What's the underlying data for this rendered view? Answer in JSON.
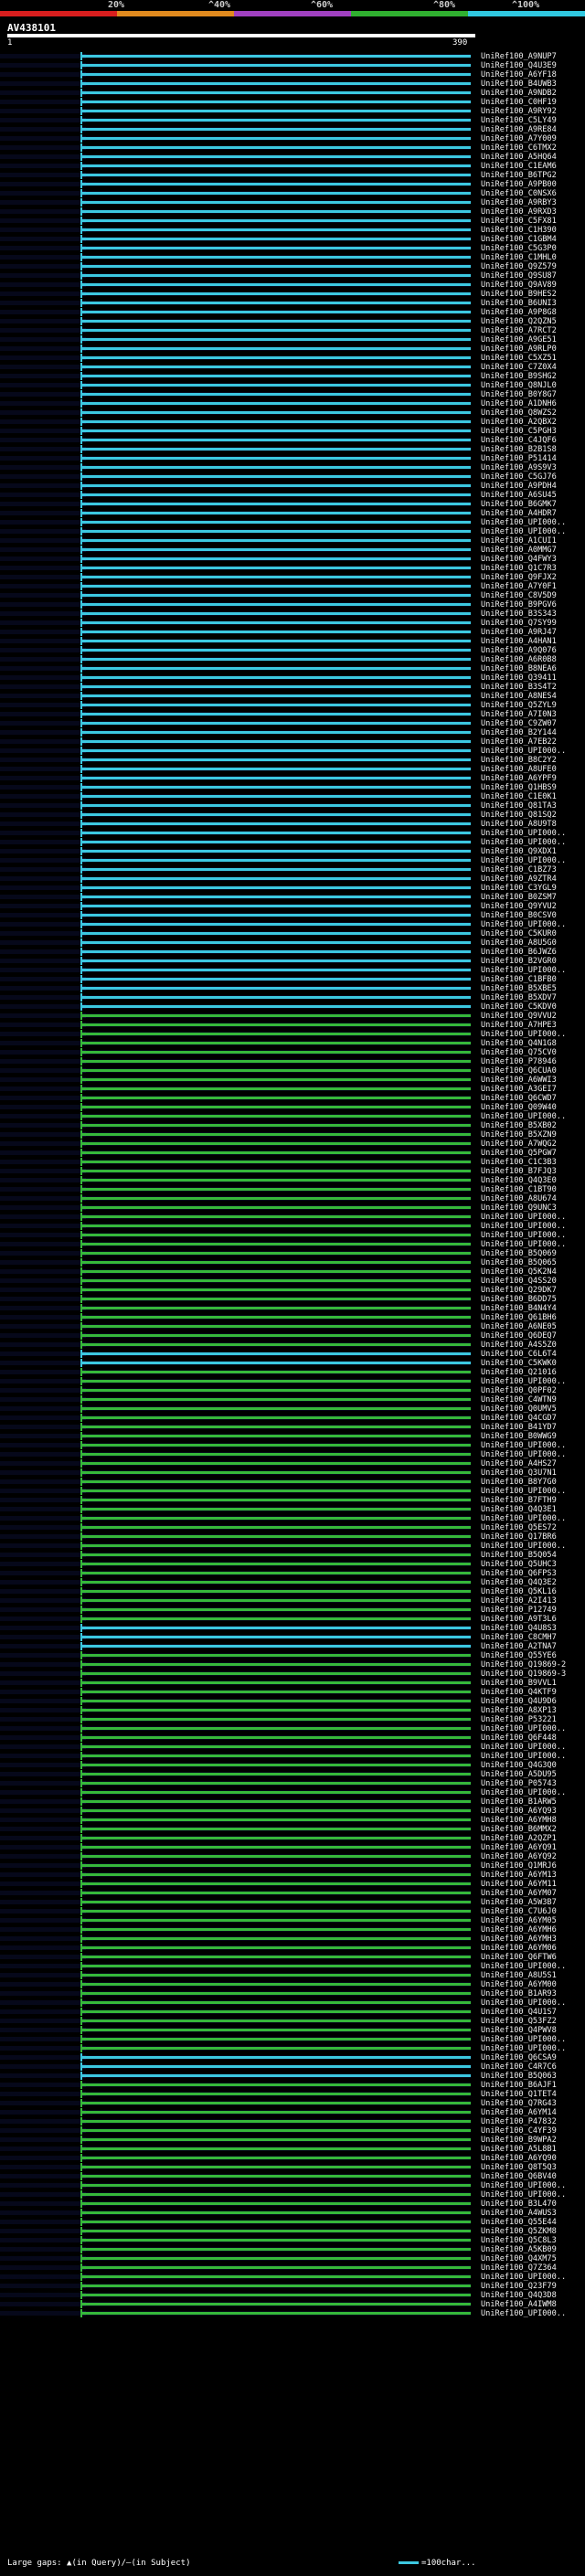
{
  "legend": {
    "labels": [
      "20%",
      "^40%",
      "^60%",
      "^80%",
      "^100%"
    ],
    "colors": [
      "#d81e1e",
      "#e08a1e",
      "#a040c0",
      "#30b030",
      "#30c8e0"
    ]
  },
  "query": {
    "name": "AV438101",
    "start": "1",
    "end": "390"
  },
  "colors": {
    "green": "#36b83a",
    "blue": "#3cc8e0",
    "background": "#000000"
  },
  "hits": [
    {
      "acc": "UniRef100_A9NUP7",
      "c": "blue"
    },
    {
      "acc": "UniRef100_Q4U3E9",
      "c": "blue"
    },
    {
      "acc": "UniRef100_A6YF18",
      "c": "blue"
    },
    {
      "acc": "UniRef100_B4UWB3",
      "c": "blue"
    },
    {
      "acc": "UniRef100_A9NDB2",
      "c": "blue"
    },
    {
      "acc": "UniRef100_C0HF19",
      "c": "blue"
    },
    {
      "acc": "UniRef100_A9RY92",
      "c": "blue"
    },
    {
      "acc": "UniRef100_C5LY49",
      "c": "blue"
    },
    {
      "acc": "UniRef100_A9RE84",
      "c": "blue"
    },
    {
      "acc": "UniRef100_A7Y009",
      "c": "blue"
    },
    {
      "acc": "UniRef100_C6TMX2",
      "c": "blue"
    },
    {
      "acc": "UniRef100_A5HQ64",
      "c": "blue"
    },
    {
      "acc": "UniRef100_C1EAM6",
      "c": "blue"
    },
    {
      "acc": "UniRef100_B6TPG2",
      "c": "blue"
    },
    {
      "acc": "UniRef100_A9PB00",
      "c": "blue"
    },
    {
      "acc": "UniRef100_C0NSX6",
      "c": "blue"
    },
    {
      "acc": "UniRef100_A9RBY3",
      "c": "blue"
    },
    {
      "acc": "UniRef100_A9RXD3",
      "c": "blue"
    },
    {
      "acc": "UniRef100_C5FX81",
      "c": "blue"
    },
    {
      "acc": "UniRef100_C1H390",
      "c": "blue"
    },
    {
      "acc": "UniRef100_C1GBM4",
      "c": "blue"
    },
    {
      "acc": "UniRef100_C5G3P0",
      "c": "blue"
    },
    {
      "acc": "UniRef100_C1MHL0",
      "c": "blue"
    },
    {
      "acc": "UniRef100_Q9Z579",
      "c": "blue"
    },
    {
      "acc": "UniRef100_Q9SU87",
      "c": "blue"
    },
    {
      "acc": "UniRef100_Q9AV89",
      "c": "blue"
    },
    {
      "acc": "UniRef100_B9HES2",
      "c": "blue"
    },
    {
      "acc": "UniRef100_B6UNI3",
      "c": "blue"
    },
    {
      "acc": "UniRef100_A9P8G8",
      "c": "blue"
    },
    {
      "acc": "UniRef100_Q2QZN5",
      "c": "blue"
    },
    {
      "acc": "UniRef100_A7RCT2",
      "c": "blue"
    },
    {
      "acc": "UniRef100_A9GE51",
      "c": "blue"
    },
    {
      "acc": "UniRef100_A9RLP0",
      "c": "blue"
    },
    {
      "acc": "UniRef100_C5XZ51",
      "c": "blue"
    },
    {
      "acc": "UniRef100_C7Z0X4",
      "c": "blue"
    },
    {
      "acc": "UniRef100_B9SHG2",
      "c": "blue"
    },
    {
      "acc": "UniRef100_Q8NJL0",
      "c": "blue"
    },
    {
      "acc": "UniRef100_B0Y8G7",
      "c": "blue"
    },
    {
      "acc": "UniRef100_A1DNH6",
      "c": "blue"
    },
    {
      "acc": "UniRef100_Q8WZS2",
      "c": "blue"
    },
    {
      "acc": "UniRef100_A2QBX2",
      "c": "blue"
    },
    {
      "acc": "UniRef100_C5PGH3",
      "c": "blue"
    },
    {
      "acc": "UniRef100_C4JQF6",
      "c": "blue"
    },
    {
      "acc": "UniRef100_B2B1S8",
      "c": "blue"
    },
    {
      "acc": "UniRef100_P51414",
      "c": "blue"
    },
    {
      "acc": "UniRef100_A9S9V3",
      "c": "blue"
    },
    {
      "acc": "UniRef100_C5GJ76",
      "c": "blue"
    },
    {
      "acc": "UniRef100_A9PDH4",
      "c": "blue"
    },
    {
      "acc": "UniRef100_A6SU45",
      "c": "blue"
    },
    {
      "acc": "UniRef100_B6GMK7",
      "c": "blue"
    },
    {
      "acc": "UniRef100_A4HDR7",
      "c": "blue"
    },
    {
      "acc": "UniRef100_UPI000..",
      "c": "blue"
    },
    {
      "acc": "UniRef100_UPI000..",
      "c": "blue"
    },
    {
      "acc": "UniRef100_A1CUI1",
      "c": "blue"
    },
    {
      "acc": "UniRef100_A0MMG7",
      "c": "blue"
    },
    {
      "acc": "UniRef100_Q4FWY3",
      "c": "blue"
    },
    {
      "acc": "UniRef100_Q1C7R3",
      "c": "blue"
    },
    {
      "acc": "UniRef100_Q9FJX2",
      "c": "blue"
    },
    {
      "acc": "UniRef100_A7Y0F1",
      "c": "blue"
    },
    {
      "acc": "UniRef100_C8V5D9",
      "c": "blue"
    },
    {
      "acc": "UniRef100_B9PGV6",
      "c": "blue"
    },
    {
      "acc": "UniRef100_B3S343",
      "c": "blue"
    },
    {
      "acc": "UniRef100_Q7SY99",
      "c": "blue"
    },
    {
      "acc": "UniRef100_A9RJ47",
      "c": "blue"
    },
    {
      "acc": "UniRef100_A4HAN1",
      "c": "blue"
    },
    {
      "acc": "UniRef100_A9Q076",
      "c": "blue"
    },
    {
      "acc": "UniRef100_A6R0B8",
      "c": "blue"
    },
    {
      "acc": "UniRef100_B8NEA6",
      "c": "blue"
    },
    {
      "acc": "UniRef100_Q39411",
      "c": "blue"
    },
    {
      "acc": "UniRef100_B3S4T2",
      "c": "blue"
    },
    {
      "acc": "UniRef100_A8NES4",
      "c": "blue"
    },
    {
      "acc": "UniRef100_Q5ZYL9",
      "c": "blue"
    },
    {
      "acc": "UniRef100_A7I0N3",
      "c": "blue"
    },
    {
      "acc": "UniRef100_C9ZW07",
      "c": "blue"
    },
    {
      "acc": "UniRef100_B2Y144",
      "c": "blue"
    },
    {
      "acc": "UniRef100_A7EB22",
      "c": "blue"
    },
    {
      "acc": "UniRef100_UPI000..",
      "c": "blue"
    },
    {
      "acc": "UniRef100_B8C2Y2",
      "c": "blue"
    },
    {
      "acc": "UniRef100_A8UFE0",
      "c": "blue"
    },
    {
      "acc": "UniRef100_A6YPF9",
      "c": "blue"
    },
    {
      "acc": "UniRef100_Q1HBS9",
      "c": "blue"
    },
    {
      "acc": "UniRef100_C1E0K1",
      "c": "blue"
    },
    {
      "acc": "UniRef100_Q81TA3",
      "c": "blue"
    },
    {
      "acc": "UniRef100_Q81SQ2",
      "c": "blue"
    },
    {
      "acc": "UniRef100_A8U9T8",
      "c": "blue"
    },
    {
      "acc": "UniRef100_UPI000..",
      "c": "blue"
    },
    {
      "acc": "UniRef100_UPI000..",
      "c": "blue"
    },
    {
      "acc": "UniRef100_Q9XDX1",
      "c": "blue"
    },
    {
      "acc": "UniRef100_UPI000..",
      "c": "blue"
    },
    {
      "acc": "UniRef100_C1BZ73",
      "c": "blue"
    },
    {
      "acc": "UniRef100_A9ZTR4",
      "c": "blue"
    },
    {
      "acc": "UniRef100_C3YGL9",
      "c": "blue"
    },
    {
      "acc": "UniRef100_B0ZSM7",
      "c": "blue"
    },
    {
      "acc": "UniRef100_Q9YVU2",
      "c": "blue"
    },
    {
      "acc": "UniRef100_B0CSV0",
      "c": "blue"
    },
    {
      "acc": "UniRef100_UPI000..",
      "c": "blue"
    },
    {
      "acc": "UniRef100_C5KUR0",
      "c": "blue"
    },
    {
      "acc": "UniRef100_A8U5G0",
      "c": "blue"
    },
    {
      "acc": "UniRef100_B6JWZ6",
      "c": "blue"
    },
    {
      "acc": "UniRef100_B2VGR0",
      "c": "blue"
    },
    {
      "acc": "UniRef100_UPI000..",
      "c": "blue"
    },
    {
      "acc": "UniRef100_C1BFB0",
      "c": "blue"
    },
    {
      "acc": "UniRef100_B5XBE5",
      "c": "blue"
    },
    {
      "acc": "UniRef100_B5XDV7",
      "c": "blue"
    },
    {
      "acc": "UniRef100_C5KDV0",
      "c": "blue"
    },
    {
      "acc": "UniRef100_Q9VVU2",
      "c": "green"
    },
    {
      "acc": "UniRef100_A7HPE3",
      "c": "green"
    },
    {
      "acc": "UniRef100_UPI000..",
      "c": "green"
    },
    {
      "acc": "UniRef100_Q4N1G8",
      "c": "green"
    },
    {
      "acc": "UniRef100_Q75CV0",
      "c": "green"
    },
    {
      "acc": "UniRef100_P78946",
      "c": "green"
    },
    {
      "acc": "UniRef100_Q6CUA0",
      "c": "green"
    },
    {
      "acc": "UniRef100_A6WWI3",
      "c": "green"
    },
    {
      "acc": "UniRef100_A3GEI7",
      "c": "green"
    },
    {
      "acc": "UniRef100_Q6CWD7",
      "c": "green"
    },
    {
      "acc": "UniRef100_Q09W40",
      "c": "green"
    },
    {
      "acc": "UniRef100_UPI000..",
      "c": "green"
    },
    {
      "acc": "UniRef100_B5XB02",
      "c": "green"
    },
    {
      "acc": "UniRef100_B5XZN9",
      "c": "green"
    },
    {
      "acc": "UniRef100_A7WQG2",
      "c": "green"
    },
    {
      "acc": "UniRef100_Q5PGW7",
      "c": "green"
    },
    {
      "acc": "UniRef100_C1C3B3",
      "c": "green"
    },
    {
      "acc": "UniRef100_B7FJQ3",
      "c": "green"
    },
    {
      "acc": "UniRef100_Q4Q3E0",
      "c": "green"
    },
    {
      "acc": "UniRef100_C1BT90",
      "c": "green"
    },
    {
      "acc": "UniRef100_A8U674",
      "c": "green"
    },
    {
      "acc": "UniRef100_Q9UNC3",
      "c": "green"
    },
    {
      "acc": "UniRef100_UPI000..",
      "c": "green"
    },
    {
      "acc": "UniRef100_UPI000..",
      "c": "green"
    },
    {
      "acc": "UniRef100_UPI000..",
      "c": "green"
    },
    {
      "acc": "UniRef100_UPI000..",
      "c": "green"
    },
    {
      "acc": "UniRef100_B5Q069",
      "c": "green"
    },
    {
      "acc": "UniRef100_B5Q065",
      "c": "green"
    },
    {
      "acc": "UniRef100_Q5K2N4",
      "c": "green"
    },
    {
      "acc": "UniRef100_Q4SS20",
      "c": "green"
    },
    {
      "acc": "UniRef100_Q29DK7",
      "c": "green"
    },
    {
      "acc": "UniRef100_B6DD75",
      "c": "green"
    },
    {
      "acc": "UniRef100_B4N4Y4",
      "c": "green"
    },
    {
      "acc": "UniRef100_Q61BH6",
      "c": "green"
    },
    {
      "acc": "UniRef100_A6NE05",
      "c": "green"
    },
    {
      "acc": "UniRef100_Q6DEQ7",
      "c": "green"
    },
    {
      "acc": "UniRef100_A4S5Z0",
      "c": "green"
    },
    {
      "acc": "UniRef100_C6L6T4",
      "c": "blue"
    },
    {
      "acc": "UniRef100_C5KWK0",
      "c": "blue"
    },
    {
      "acc": "UniRef100_Q21016",
      "c": "green"
    },
    {
      "acc": "UniRef100_UPI000..",
      "c": "green"
    },
    {
      "acc": "UniRef100_Q0PF02",
      "c": "green"
    },
    {
      "acc": "UniRef100_C4WTN9",
      "c": "green"
    },
    {
      "acc": "UniRef100_Q0UMV5",
      "c": "green"
    },
    {
      "acc": "UniRef100_Q4CGD7",
      "c": "green"
    },
    {
      "acc": "UniRef100_B41YD7",
      "c": "green"
    },
    {
      "acc": "UniRef100_B0WWG9",
      "c": "green"
    },
    {
      "acc": "UniRef100_UPI000..",
      "c": "green"
    },
    {
      "acc": "UniRef100_UPI000..",
      "c": "green"
    },
    {
      "acc": "UniRef100_A4HS27",
      "c": "green"
    },
    {
      "acc": "UniRef100_Q3U7N1",
      "c": "green"
    },
    {
      "acc": "UniRef100_B8Y7G0",
      "c": "green"
    },
    {
      "acc": "UniRef100_UPI000..",
      "c": "green"
    },
    {
      "acc": "UniRef100_B7FTH9",
      "c": "green"
    },
    {
      "acc": "UniRef100_Q4Q3E1",
      "c": "green"
    },
    {
      "acc": "UniRef100_UPI000..",
      "c": "green"
    },
    {
      "acc": "UniRef100_Q5ES72",
      "c": "green"
    },
    {
      "acc": "UniRef100_Q17BR6",
      "c": "green"
    },
    {
      "acc": "UniRef100_UPI000..",
      "c": "green"
    },
    {
      "acc": "UniRef100_B5Q054",
      "c": "green"
    },
    {
      "acc": "UniRef100_Q5UHC3",
      "c": "green"
    },
    {
      "acc": "UniRef100_Q6FPS3",
      "c": "green"
    },
    {
      "acc": "UniRef100_Q4Q3E2",
      "c": "green"
    },
    {
      "acc": "UniRef100_Q5KL16",
      "c": "green"
    },
    {
      "acc": "UniRef100_A2I413",
      "c": "green"
    },
    {
      "acc": "UniRef100_P12749",
      "c": "green"
    },
    {
      "acc": "UniRef100_A9T3L6",
      "c": "green"
    },
    {
      "acc": "UniRef100_Q4U8S3",
      "c": "blue"
    },
    {
      "acc": "UniRef100_C8CMH7",
      "c": "blue"
    },
    {
      "acc": "UniRef100_A2TNA7",
      "c": "blue"
    },
    {
      "acc": "UniRef100_Q55YE6",
      "c": "green"
    },
    {
      "acc": "UniRef100_Q19869-2",
      "c": "green"
    },
    {
      "acc": "UniRef100_Q19869-3",
      "c": "green"
    },
    {
      "acc": "UniRef100_B9VVL1",
      "c": "green"
    },
    {
      "acc": "UniRef100_Q4KTF9",
      "c": "green"
    },
    {
      "acc": "UniRef100_Q4U9D6",
      "c": "green"
    },
    {
      "acc": "UniRef100_A8XP13",
      "c": "green"
    },
    {
      "acc": "UniRef100_P53221",
      "c": "green"
    },
    {
      "acc": "UniRef100_UPI000..",
      "c": "green"
    },
    {
      "acc": "UniRef100_Q6F448",
      "c": "green"
    },
    {
      "acc": "UniRef100_UPI000..",
      "c": "green"
    },
    {
      "acc": "UniRef100_UPI000..",
      "c": "green"
    },
    {
      "acc": "UniRef100_Q4G3Q0",
      "c": "green"
    },
    {
      "acc": "UniRef100_A5DU95",
      "c": "green"
    },
    {
      "acc": "UniRef100_P05743",
      "c": "green"
    },
    {
      "acc": "UniRef100_UPI000..",
      "c": "green"
    },
    {
      "acc": "UniRef100_B1ARW5",
      "c": "green"
    },
    {
      "acc": "UniRef100_A6YQ93",
      "c": "green"
    },
    {
      "acc": "UniRef100_A6YMH8",
      "c": "green"
    },
    {
      "acc": "UniRef100_B6MMX2",
      "c": "green"
    },
    {
      "acc": "UniRef100_A2QZP1",
      "c": "green"
    },
    {
      "acc": "UniRef100_A6YQ91",
      "c": "green"
    },
    {
      "acc": "UniRef100_A6YQ92",
      "c": "green"
    },
    {
      "acc": "UniRef100_Q1MRJ6",
      "c": "green"
    },
    {
      "acc": "UniRef100_A6YM13",
      "c": "green"
    },
    {
      "acc": "UniRef100_A6YM11",
      "c": "green"
    },
    {
      "acc": "UniRef100_A6YM07",
      "c": "green"
    },
    {
      "acc": "UniRef100_A5W3B7",
      "c": "green"
    },
    {
      "acc": "UniRef100_C7U6J0",
      "c": "green"
    },
    {
      "acc": "UniRef100_A6YM05",
      "c": "green"
    },
    {
      "acc": "UniRef100_A6YMH6",
      "c": "green"
    },
    {
      "acc": "UniRef100_A6YMH3",
      "c": "green"
    },
    {
      "acc": "UniRef100_A6YM06",
      "c": "green"
    },
    {
      "acc": "UniRef100_Q6FTW6",
      "c": "green"
    },
    {
      "acc": "UniRef100_UPI000..",
      "c": "green"
    },
    {
      "acc": "UniRef100_A8U5S1",
      "c": "green"
    },
    {
      "acc": "UniRef100_A6YM00",
      "c": "green"
    },
    {
      "acc": "UniRef100_B1AR93",
      "c": "green"
    },
    {
      "acc": "UniRef100_UPI000..",
      "c": "green"
    },
    {
      "acc": "UniRef100_Q4U1S7",
      "c": "green"
    },
    {
      "acc": "UniRef100_Q53FZ2",
      "c": "green"
    },
    {
      "acc": "UniRef100_Q4PWV8",
      "c": "green"
    },
    {
      "acc": "UniRef100_UPI000..",
      "c": "green"
    },
    {
      "acc": "UniRef100_UPI000..",
      "c": "green"
    },
    {
      "acc": "UniRef100_Q6CSA9",
      "c": "blue"
    },
    {
      "acc": "UniRef100_C4R7C6",
      "c": "blue"
    },
    {
      "acc": "UniRef100_B5Q063",
      "c": "blue"
    },
    {
      "acc": "UniRef100_B6AJF1",
      "c": "green"
    },
    {
      "acc": "UniRef100_Q1TET4",
      "c": "green"
    },
    {
      "acc": "UniRef100_Q7RG43",
      "c": "green"
    },
    {
      "acc": "UniRef100_A6YM14",
      "c": "green"
    },
    {
      "acc": "UniRef100_P47832",
      "c": "green"
    },
    {
      "acc": "UniRef100_C4YF39",
      "c": "green"
    },
    {
      "acc": "UniRef100_B9WPA2",
      "c": "green"
    },
    {
      "acc": "UniRef100_A5L8B1",
      "c": "green"
    },
    {
      "acc": "UniRef100_A6YQ90",
      "c": "green"
    },
    {
      "acc": "UniRef100_Q8T5Q3",
      "c": "green"
    },
    {
      "acc": "UniRef100_Q6BV40",
      "c": "green"
    },
    {
      "acc": "UniRef100_UPI000..",
      "c": "green"
    },
    {
      "acc": "UniRef100_UPI000..",
      "c": "green"
    },
    {
      "acc": "UniRef100_B3L470",
      "c": "green"
    },
    {
      "acc": "UniRef100_A4WUS3",
      "c": "green"
    },
    {
      "acc": "UniRef100_Q55E44",
      "c": "green"
    },
    {
      "acc": "UniRef100_Q5ZKM8",
      "c": "green"
    },
    {
      "acc": "UniRef100_Q5C8L3",
      "c": "green"
    },
    {
      "acc": "UniRef100_A5KB09",
      "c": "green"
    },
    {
      "acc": "UniRef100_Q4XM75",
      "c": "green"
    },
    {
      "acc": "UniRef100_Q7Z364",
      "c": "green"
    },
    {
      "acc": "UniRef100_UPI000..",
      "c": "green"
    },
    {
      "acc": "UniRef100_Q23F79",
      "c": "green"
    },
    {
      "acc": "UniRef100_Q4Q3D8",
      "c": "green"
    },
    {
      "acc": "UniRef100_A4IWM8",
      "c": "green"
    },
    {
      "acc": "UniRef100_UPI000..",
      "c": "green"
    }
  ],
  "footer": {
    "left": "Large gaps: ▲(in Query)/—(in Subject)",
    "right": "=100char..."
  }
}
